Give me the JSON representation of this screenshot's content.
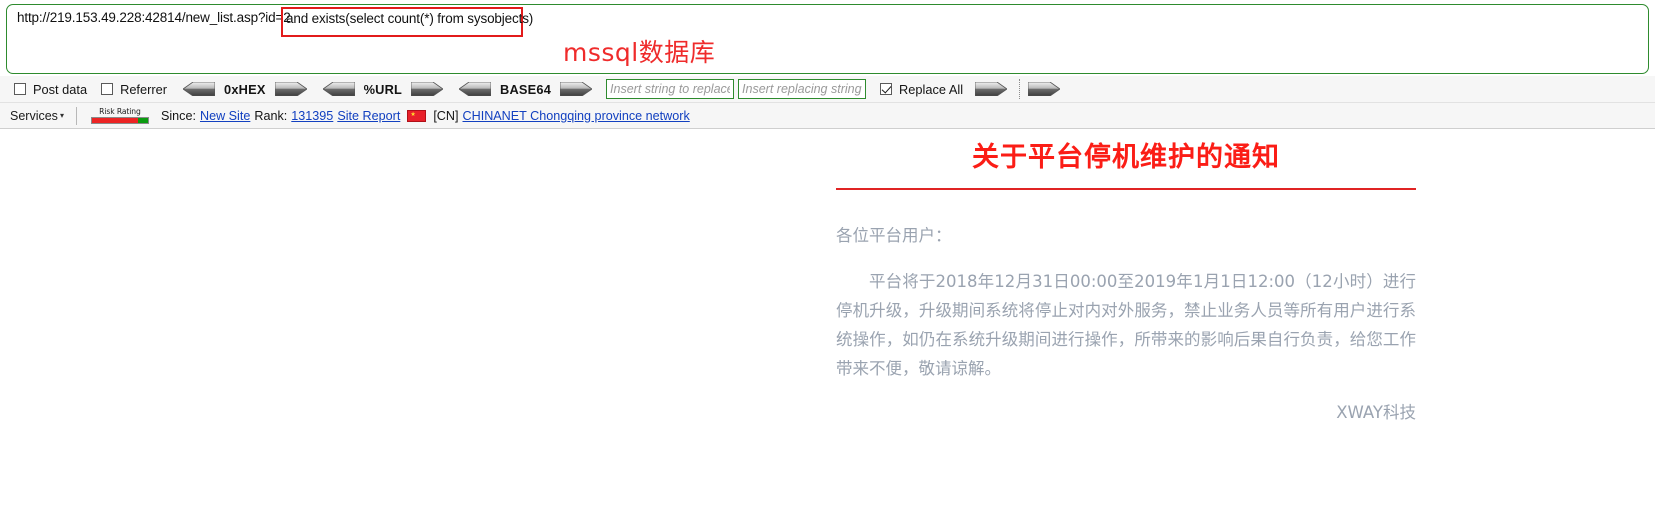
{
  "url_panel": {
    "base_url": "http://219.153.49.228:42814/new_list.asp?id=2",
    "injected_payload": "and exists(select count(*) from sysobjects)",
    "annotation": "mssql数据库"
  },
  "toolbar": {
    "post_data_label": "Post data",
    "post_data_checked": false,
    "referrer_label": "Referrer",
    "referrer_checked": false,
    "hex_label": "0xHEX",
    "url_label": "%URL",
    "base64_label": "BASE64",
    "replace_search_placeholder": "Insert string to replace",
    "replace_search_value": "",
    "replace_with_placeholder": "Insert replacing string",
    "replace_with_value": "",
    "replace_all_label": "Replace All",
    "replace_all_checked": true
  },
  "services_bar": {
    "services_label": "Services",
    "risk_rating_caption": "Risk Rating",
    "since_label": "Since:",
    "new_site_link": "New Site",
    "rank_label": "Rank:",
    "rank_value": "131395",
    "site_report_link": "Site Report",
    "country_code": "[CN]",
    "network_link": "CHINANET Chongqing province network"
  },
  "notice": {
    "title": "关于平台停机维护的通知",
    "salutation": "各位平台用户：",
    "paragraph": "平台将于2018年12月31日00:00至2019年1月1日12:00（12小时）进行停机升级，升级期间系统将停止对内对外服务，禁止业务人员等所有用户进行系统操作，如仍在系统升级期间进行操作，所带来的影响后果自行负责，给您工作带来不便，敬请谅解。",
    "signature": "XWAY科技"
  },
  "colors": {
    "panel_border_green": "#2e8b2e",
    "payload_highlight_red": "#e21b1b",
    "annotation_red": "#ef2b2b",
    "title_red": "#fb1d16",
    "body_gray": "#9aa3b0",
    "link_blue": "#1240c0"
  }
}
